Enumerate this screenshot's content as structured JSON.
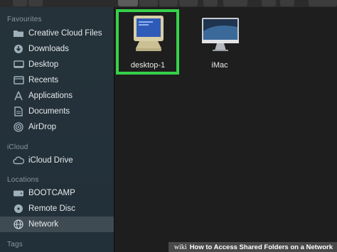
{
  "sidebar": {
    "favourites_header": "Favourites",
    "favourites": [
      {
        "label": "Creative Cloud Files",
        "icon": "folder-icon"
      },
      {
        "label": "Downloads",
        "icon": "downloads-icon"
      },
      {
        "label": "Desktop",
        "icon": "desktop-icon"
      },
      {
        "label": "Recents",
        "icon": "recents-icon"
      },
      {
        "label": "Applications",
        "icon": "applications-icon"
      },
      {
        "label": "Documents",
        "icon": "documents-icon"
      },
      {
        "label": "AirDrop",
        "icon": "airdrop-icon"
      }
    ],
    "icloud_header": "iCloud",
    "icloud": [
      {
        "label": "iCloud Drive",
        "icon": "icloud-icon"
      }
    ],
    "locations_header": "Locations",
    "locations": [
      {
        "label": "BOOTCAMP",
        "icon": "drive-icon"
      },
      {
        "label": "Remote Disc",
        "icon": "disc-icon"
      },
      {
        "label": "Network",
        "icon": "network-icon",
        "selected": true
      }
    ],
    "tags_header": "Tags"
  },
  "files": [
    {
      "label": "desktop-1",
      "icon": "pc-monitor-icon",
      "selected": true
    },
    {
      "label": "iMac",
      "icon": "imac-icon"
    }
  ],
  "watermark": {
    "brand": "wiki",
    "title": "How to Access Shared Folders on a Network"
  },
  "colors": {
    "selection_highlight": "#36d14a",
    "sidebar_bg": "#24313a",
    "main_bg": "#1e1e1e"
  }
}
